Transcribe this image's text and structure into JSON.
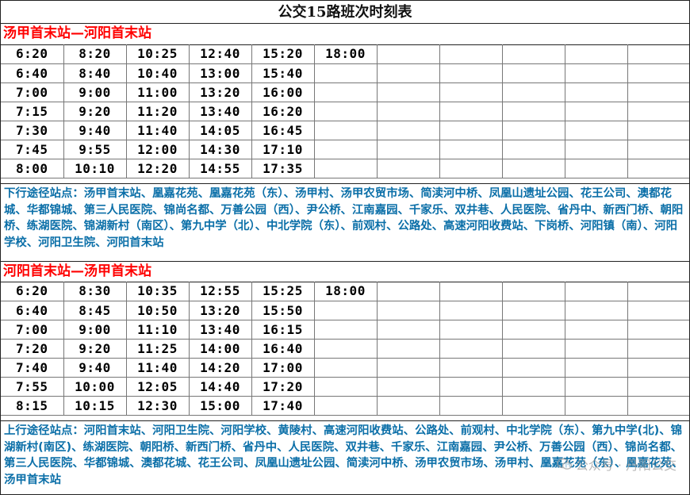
{
  "title": "公交15路班次时刻表",
  "downbound": {
    "header": "汤甲首末站—河阳首末站",
    "rows": [
      [
        "6:20",
        "8:20",
        "10:25",
        "12:40",
        "15:20",
        "18:00",
        "",
        "",
        "",
        "",
        ""
      ],
      [
        "6:40",
        "8:40",
        "10:40",
        "13:00",
        "15:40",
        "",
        "",
        "",
        "",
        "",
        ""
      ],
      [
        "7:00",
        "9:00",
        "11:00",
        "13:20",
        "16:00",
        "",
        "",
        "",
        "",
        "",
        ""
      ],
      [
        "7:15",
        "9:20",
        "11:20",
        "13:40",
        "16:20",
        "",
        "",
        "",
        "",
        "",
        ""
      ],
      [
        "7:30",
        "9:40",
        "11:40",
        "14:05",
        "16:45",
        "",
        "",
        "",
        "",
        "",
        ""
      ],
      [
        "7:45",
        "9:55",
        "12:00",
        "14:30",
        "17:10",
        "",
        "",
        "",
        "",
        "",
        ""
      ],
      [
        "8:00",
        "10:10",
        "12:20",
        "14:55",
        "17:35",
        "",
        "",
        "",
        "",
        "",
        ""
      ]
    ],
    "stops": "下行途径站点：汤甲首末站、凰嘉花苑、凰嘉花苑（东）、汤甲村、汤甲农贸市场、简渎河中桥、凤凰山遗址公园、花王公司、澳都花城、华都锦城、第三人民医院、锦尚名都、万善公园（西）、尹公桥、江南嘉园、千家乐、双井巷、人民医院、省丹中、新西门桥、朝阳桥、练湖医院、锦湖新村（南区）、第九中学（北）、中北学院（东）、前观村、公路处、高速河阳收费站、下岗桥、河阳镇（南）、河阳学校、河阳卫生院、河阳首末站"
  },
  "upbound": {
    "header": "河阳首末站—汤甲首末站",
    "rows": [
      [
        "6:20",
        "8:30",
        "10:35",
        "12:55",
        "15:25",
        "18:00",
        "",
        "",
        "",
        "",
        ""
      ],
      [
        "6:40",
        "8:45",
        "10:50",
        "13:20",
        "15:50",
        "",
        "",
        "",
        "",
        "",
        ""
      ],
      [
        "7:00",
        "9:00",
        "11:10",
        "13:40",
        "16:15",
        "",
        "",
        "",
        "",
        "",
        ""
      ],
      [
        "7:20",
        "9:20",
        "11:25",
        "14:00",
        "16:40",
        "",
        "",
        "",
        "",
        "",
        ""
      ],
      [
        "7:40",
        "9:40",
        "11:40",
        "14:20",
        "17:00",
        "",
        "",
        "",
        "",
        "",
        ""
      ],
      [
        "7:55",
        "10:00",
        "12:05",
        "14:40",
        "17:20",
        "",
        "",
        "",
        "",
        "",
        ""
      ],
      [
        "8:15",
        "10:15",
        "12:30",
        "15:00",
        "17:40",
        "",
        "",
        "",
        "",
        "",
        ""
      ]
    ],
    "stops": "上行途径站点：河阳首末站、河阳卫生院、河阳学校、黄陵村、高速河阳收费站、公路处、前观村、中北学院（东）、第九中学(北)、锦湖新村(南区)、练湖医院、朝阳桥、新西门桥、省丹中、人民医院、双井巷、千家乐、江南嘉园、尹公桥、万善公园（西）、锦尚名都、第三人民医院、华都锦城、澳都花城、花王公司、凤凰山遗址公园、简渎河中桥、汤甲农贸市场、汤甲村、凰嘉花苑（东）、凰嘉花苑、汤甲首末站"
  },
  "watermark": "公众号 · 丹阳公交",
  "colors": {
    "header_red": "#ff0000",
    "stops_blue": "#0b6fa8",
    "border": "#222222"
  }
}
